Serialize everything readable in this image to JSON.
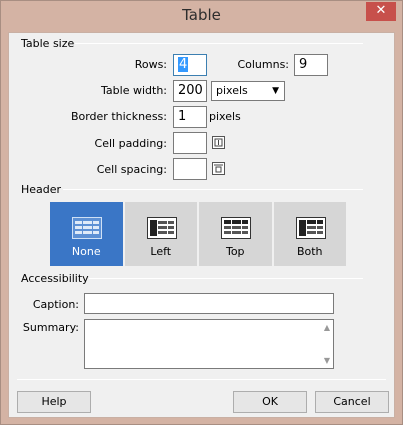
{
  "window": {
    "title": "Table",
    "close_glyph": "✕"
  },
  "table_size": {
    "group_label": "Table size",
    "rows_label": "Rows:",
    "rows_value": "4",
    "columns_label": "Columns:",
    "columns_value": "9",
    "width_label": "Table width:",
    "width_value": "200",
    "width_unit": "pixels",
    "border_label": "Border thickness:",
    "border_value": "1",
    "border_unit": "pixels",
    "padding_label": "Cell padding:",
    "padding_value": "",
    "spacing_label": "Cell spacing:",
    "spacing_value": ""
  },
  "header": {
    "group_label": "Header",
    "options": [
      {
        "label": "None",
        "selected": true
      },
      {
        "label": "Left",
        "selected": false
      },
      {
        "label": "Top",
        "selected": false
      },
      {
        "label": "Both",
        "selected": false
      }
    ]
  },
  "accessibility": {
    "group_label": "Accessibility",
    "caption_label": "Caption:",
    "caption_value": "",
    "summary_label": "Summary:",
    "summary_value": ""
  },
  "buttons": {
    "help": "Help",
    "ok": "OK",
    "cancel": "Cancel"
  }
}
